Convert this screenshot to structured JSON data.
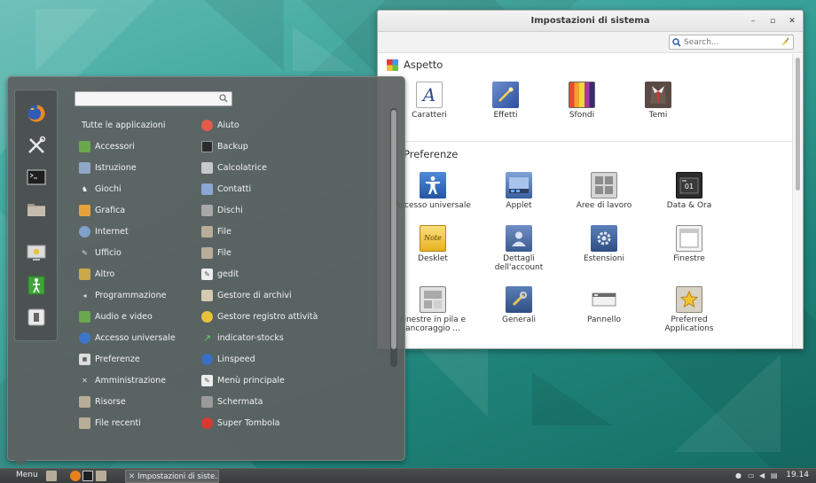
{
  "colors": {
    "menu_bg": "#5c6060",
    "taskbar_bg": "#3e4242",
    "settings_bg": "#ffffff",
    "desktop_teal": "#2a8f87"
  },
  "settings": {
    "title": "Impostazioni di sistema",
    "search_placeholder": "Search...",
    "sections": {
      "aspetto": {
        "label": "Aspetto",
        "items": [
          "Caratteri",
          "Effetti",
          "Sfondi",
          "Temi"
        ]
      },
      "preferenze": {
        "label": "Preferenze",
        "items": [
          "Accesso universale",
          "Applet",
          "Aree di lavoro",
          "Data & Ora",
          "Desklet",
          "Dettagli dell'account",
          "Estensioni",
          "Finestre",
          "Finestre in pila e ancoraggio ...",
          "Generali",
          "Pannello",
          "Preferred Applications"
        ]
      }
    },
    "icons": {
      "caratteri": "font-icon",
      "effetti": "effects-icon",
      "sfondi": "backgrounds-icon",
      "temi": "themes-icon",
      "accesso": "accessibility-icon",
      "applet": "applet-icon",
      "aree": "workspaces-icon",
      "data": "calendar-icon",
      "desklet": "desklet-icon",
      "account": "user-icon",
      "estensioni": "extensions-gear-icon",
      "finestre": "window-icon",
      "pila": "tiling-icon",
      "generali": "tools-icon",
      "pannello": "panel-icon",
      "preferred": "star-icon"
    }
  },
  "menu": {
    "search_value": "",
    "categories": [
      "Tutte le applicazioni",
      "Accessori",
      "Istruzione",
      "Giochi",
      "Grafica",
      "Internet",
      "Ufficio",
      "Altro",
      "Programmazione",
      "Audio e video",
      "Accesso universale",
      "Preferenze",
      "Amministrazione",
      "Risorse",
      "File recenti"
    ],
    "apps": [
      "Aiuto",
      "Backup",
      "Calcolatrice",
      "Contatti",
      "Dischi",
      "File",
      "File",
      "gedit",
      "Gestore di archivi",
      "Gestore registro attività",
      "indicator-stocks",
      "Linspeed",
      "Menù principale",
      "Schermata",
      "Super Tombola"
    ],
    "favorites": [
      "firefox-icon",
      "system-settings-icon",
      "terminal-icon",
      "folder-icon",
      "lock-screen-icon",
      "logout-icon",
      "shutdown-icon"
    ]
  },
  "taskbar": {
    "menu_label": "Menu",
    "window_label": "Impostazioni di siste...",
    "clock": "19.14"
  }
}
